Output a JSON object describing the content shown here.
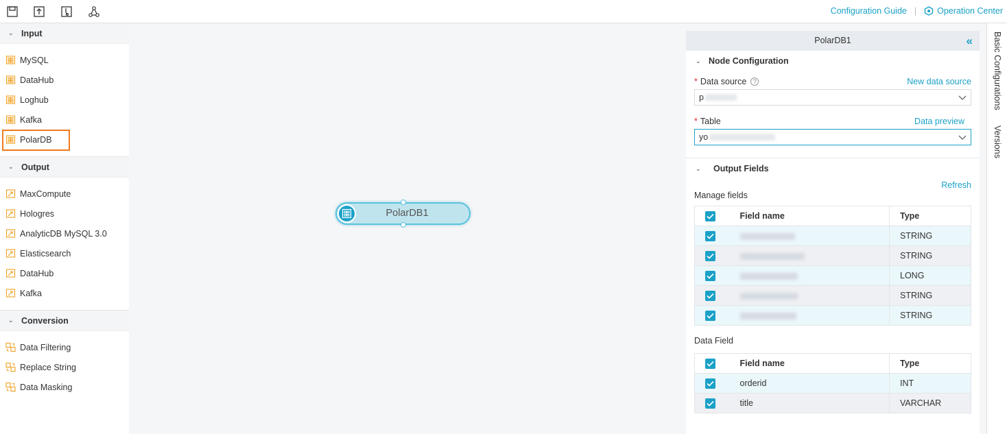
{
  "toolbar": {
    "icons": [
      "save-icon",
      "submit-icon",
      "deploy-icon",
      "graph-icon"
    ],
    "config_guide": "Configuration Guide",
    "operation_center": "Operation Center"
  },
  "sidebar": {
    "sections": [
      {
        "title": "Input",
        "items": [
          "MySQL",
          "DataHub",
          "Loghub",
          "Kafka",
          "PolarDB"
        ],
        "selected": "PolarDB"
      },
      {
        "title": "Output",
        "items": [
          "MaxCompute",
          "Hologres",
          "AnalyticDB MySQL 3.0",
          "Elasticsearch",
          "DataHub",
          "Kafka"
        ]
      },
      {
        "title": "Conversion",
        "items": [
          "Data Filtering",
          "Replace String",
          "Data Masking"
        ]
      }
    ]
  },
  "canvas": {
    "node": {
      "label": "PolarDB1"
    }
  },
  "config": {
    "title": "PolarDB1",
    "node_configuration": {
      "header": "Node Configuration",
      "data_source_label": "Data source",
      "data_source_value": "p",
      "new_data_source": "New data source",
      "table_label": "Table",
      "table_value": "yo",
      "data_preview": "Data preview"
    },
    "output_fields": {
      "header": "Output Fields",
      "refresh": "Refresh",
      "manage_fields_label": "Manage fields",
      "columns": [
        "Field name",
        "Type"
      ],
      "rows": [
        {
          "name": "",
          "type": "STRING"
        },
        {
          "name": "",
          "type": "STRING"
        },
        {
          "name": "",
          "type": "LONG"
        },
        {
          "name": "",
          "type": "STRING"
        },
        {
          "name": "",
          "type": "STRING"
        }
      ],
      "data_field_label": "Data Field",
      "data_columns": [
        "Field name",
        "Type"
      ],
      "data_rows": [
        {
          "name": "orderid",
          "type": "INT"
        },
        {
          "name": "title",
          "type": "VARCHAR"
        }
      ]
    }
  },
  "tabs": {
    "basic": "Basic Configurations",
    "versions": "Versions"
  },
  "colors": {
    "accent": "#1ba1c7",
    "highlight": "#ee7a1d",
    "icon": "#f0a021",
    "required": "#e0242e"
  }
}
